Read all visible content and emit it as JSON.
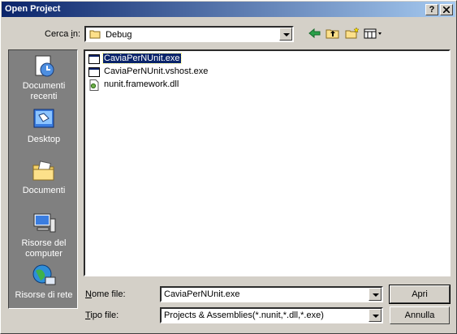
{
  "window": {
    "title": "Open Project",
    "help_label": "?",
    "close_label": "✕"
  },
  "lookin": {
    "label": "Cerca in:",
    "value": "Debug",
    "folder_icon": "folder-icon"
  },
  "toolbar": {
    "icons": [
      "back-icon",
      "up-folder-icon",
      "new-folder-icon",
      "view-menu-icon"
    ]
  },
  "places": [
    {
      "label": "Documenti recenti",
      "icon": "recent-documents-icon"
    },
    {
      "label": "Desktop",
      "icon": "desktop-icon"
    },
    {
      "label": "Documenti",
      "icon": "documents-folder-icon"
    },
    {
      "label": "Risorse del computer",
      "icon": "my-computer-icon"
    },
    {
      "label": "Risorse di rete",
      "icon": "network-icon"
    }
  ],
  "files": [
    {
      "name": "CaviaPerNUnit.exe",
      "icon": "exe-icon",
      "selected": true
    },
    {
      "name": "CaviaPerNUnit.vshost.exe",
      "icon": "exe-icon",
      "selected": false
    },
    {
      "name": "nunit.framework.dll",
      "icon": "dll-icon",
      "selected": false
    }
  ],
  "filename": {
    "label": "Nome file:",
    "value": "CaviaPerNUnit.exe"
  },
  "filetype": {
    "label": "Tipo file:",
    "value": "Projects & Assemblies(*.nunit,*.dll,*.exe)"
  },
  "buttons": {
    "open": "Apri",
    "cancel": "Annulla"
  },
  "colors": {
    "title_start": "#0a246a",
    "title_end": "#a6caf0",
    "face": "#d4d0c8",
    "places_bg": "#808080",
    "selection": "#0a246a"
  }
}
